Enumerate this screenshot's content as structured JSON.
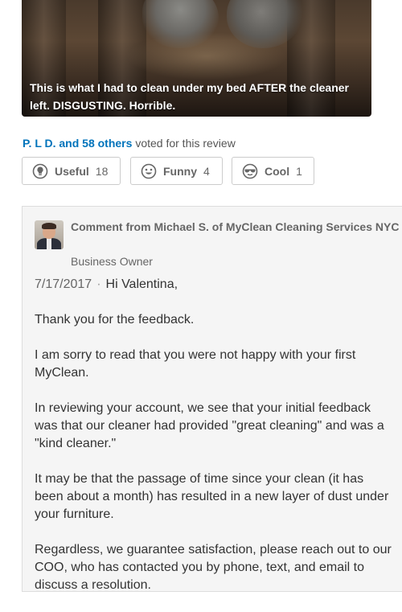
{
  "photo": {
    "caption": "This is what I had to clean under my bed AFTER the cleaner left. DISGUSTING. Horrible."
  },
  "votes": {
    "voters_link": "P. L D. and 58 others",
    "suffix": "voted for this review"
  },
  "buttons": [
    {
      "label": "Useful",
      "count": "18",
      "icon": "lightbulb-icon"
    },
    {
      "label": "Funny",
      "count": "4",
      "icon": "smile-icon"
    },
    {
      "label": "Cool",
      "count": "1",
      "icon": "sunglasses-icon"
    }
  ],
  "comment": {
    "header": "Comment from Michael S. of MyClean Cleaning Services NYC",
    "role": "Business Owner",
    "date": "7/17/2017",
    "separator": "·",
    "greeting": "Hi Valentina,",
    "paragraphs": [
      "Thank you for the feedback.",
      "I am sorry to read that you were not happy with your first MyClean.",
      "In reviewing your account, we see that your initial feedback was that our cleaner had provided \"great cleaning\" and was a \"kind cleaner.\"",
      "It may be that the passage of time since your clean (it has been about a month) has resulted in a new layer of dust under your furniture.",
      "Regardless, we guarantee satisfaction, please reach out to our COO, who has contacted you by phone, text, and email to discuss a resolution."
    ]
  },
  "colors": {
    "link": "#0073bb",
    "border": "#cccccc",
    "comment_bg": "#f5f5f5"
  }
}
